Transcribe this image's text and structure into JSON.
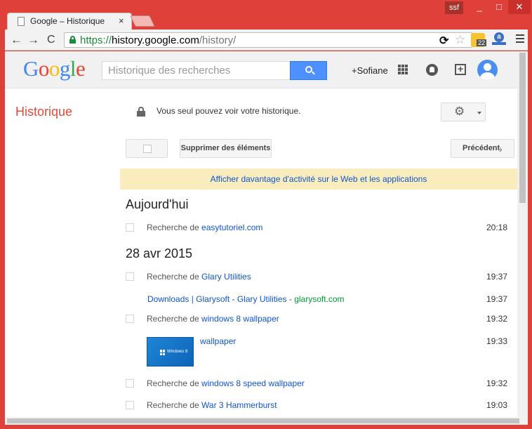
{
  "window": {
    "user_badge": "ssf",
    "minimize": "_",
    "maximize": "□",
    "close": "✕"
  },
  "tab": {
    "title": "Google – Historique",
    "close": "×"
  },
  "toolbar": {
    "back": "←",
    "forward": "→",
    "reload": "C",
    "url_scheme": "https://",
    "url_host": "history.google.com",
    "url_path": "/history/",
    "ext_badge": "22",
    "ext_letter": "a"
  },
  "google": {
    "logo": [
      {
        "ch": "G",
        "color": "#4285f4"
      },
      {
        "ch": "o",
        "color": "#ea4335"
      },
      {
        "ch": "o",
        "color": "#fbbc05"
      },
      {
        "ch": "g",
        "color": "#4285f4"
      },
      {
        "ch": "l",
        "color": "#34a853"
      },
      {
        "ch": "e",
        "color": "#ea4335"
      }
    ],
    "search_placeholder": "Historique des recherches",
    "user_link": "+Sofiane"
  },
  "subheader": {
    "title": "Historique",
    "privacy": "Vous seul pouvez voir votre historique.",
    "gear": "⚙"
  },
  "actions": {
    "delete": "Supprimer des éléments",
    "previous": "Précédent",
    "chevron": "›"
  },
  "banner": "Afficher davantage d'activité sur le Web et les applications",
  "days": [
    {
      "label": "Aujourd'hui",
      "items": [
        {
          "prefix": "Recherche de ",
          "link": "easytutoriel.com",
          "time": "20:18",
          "checkbox": true
        }
      ]
    },
    {
      "label": "28 avr 2015",
      "items": [
        {
          "prefix": "Recherche de ",
          "link": "Glary Utilities",
          "time": "19:37",
          "checkbox": true
        },
        {
          "prefix": "",
          "link": "Downloads | Glarysoft - Glary Utilities",
          "sep": " - ",
          "domain": "glarysoft.com",
          "time": "19:37",
          "checkbox": false
        },
        {
          "prefix": "Recherche de ",
          "link": "windows 8 wallpaper",
          "time": "19:32",
          "checkbox": true
        },
        {
          "prefix": "",
          "link": "wallpaper",
          "time": "19:33",
          "checkbox": false,
          "thumb_text": "Windows 8"
        },
        {
          "prefix": "Recherche de ",
          "link": "windows 8 speed wallpaper",
          "time": "19:32",
          "checkbox": true
        },
        {
          "prefix": "Recherche de ",
          "link": "War 3 Hammerburst",
          "time": "19:03",
          "checkbox": true
        }
      ]
    }
  ]
}
